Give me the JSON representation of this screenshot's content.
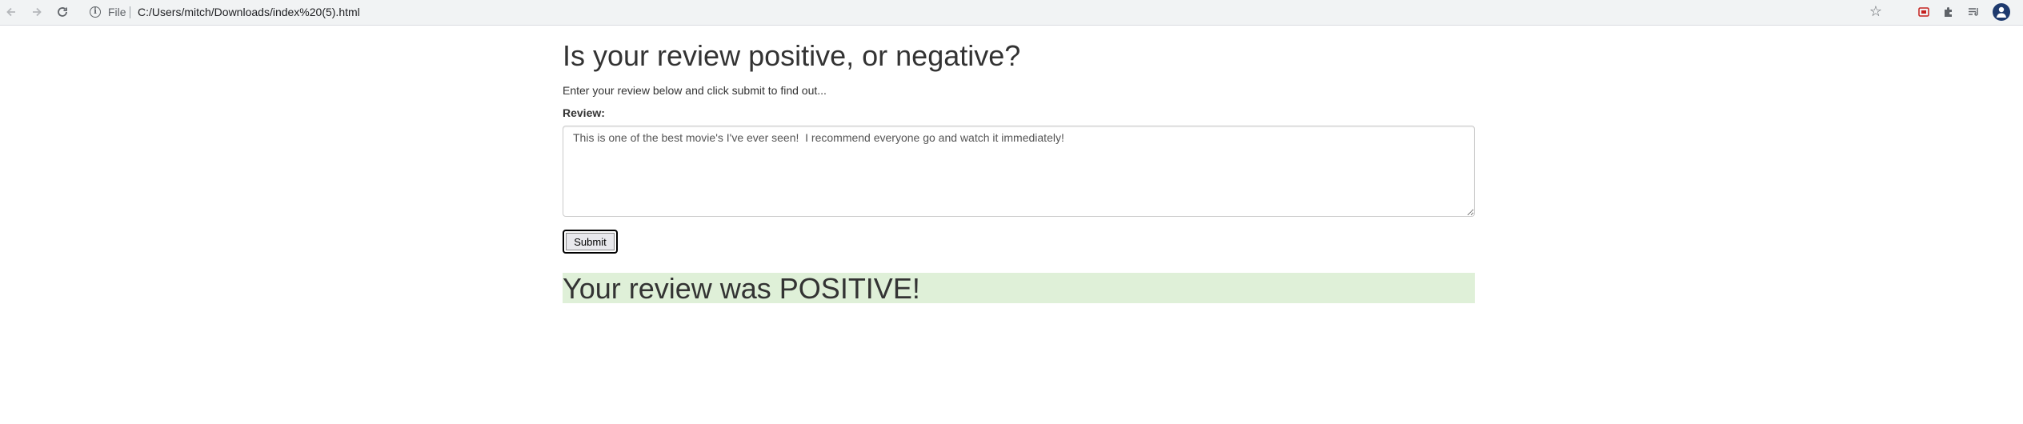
{
  "browser": {
    "scheme_label": "File",
    "url": "C:/Users/mitch/Downloads/index%20(5).html"
  },
  "page": {
    "title": "Is your review positive, or negative?",
    "subtitle": "Enter your review below and click submit to find out...",
    "review_label": "Review:",
    "review_value": "This is one of the best movie's I've ever seen!  I recommend everyone go and watch it immediately!",
    "submit_label": "Submit",
    "result_text": "Your review was POSITIVE!"
  },
  "colors": {
    "result_background": "#dff0d8",
    "text": "#333333"
  }
}
